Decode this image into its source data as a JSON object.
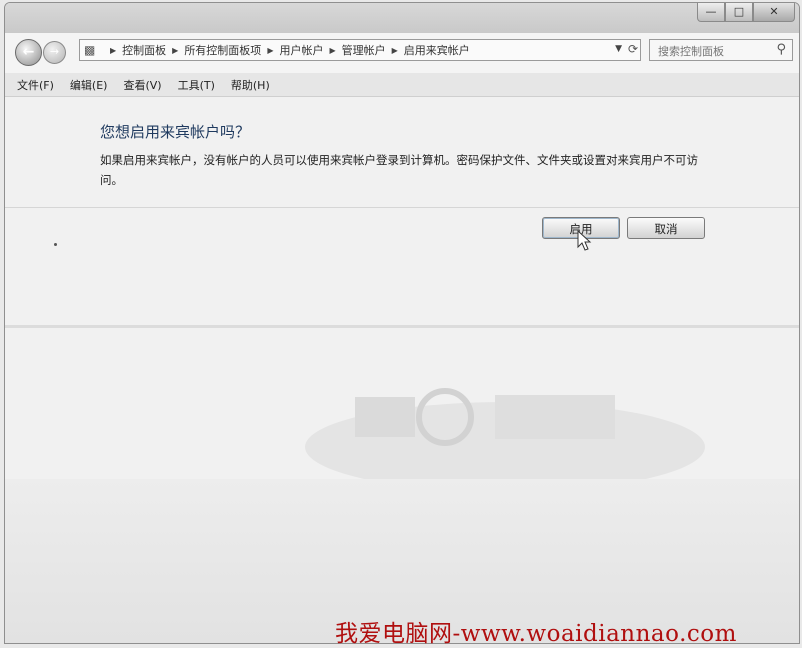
{
  "window": {
    "caption": {
      "minimize": "—",
      "maximize": "□",
      "close": "✕"
    }
  },
  "navigation": {
    "back_icon": "back-arrow-icon",
    "forward_icon": "forward-arrow-icon",
    "breadcrumbs": [
      "控制面板",
      "所有控制面板项",
      "用户帐户",
      "管理帐户",
      "启用来宾帐户"
    ],
    "search_placeholder": "搜索控制面板"
  },
  "menu": {
    "items": [
      "文件(F)",
      "编辑(E)",
      "查看(V)",
      "工具(T)",
      "帮助(H)"
    ]
  },
  "dialog": {
    "title": "您想启用来宾帐户吗？",
    "message": "如果启用来宾帐户，没有帐户的人员可以使用来宾帐户登录到计算机。密码保护文件、文件夹或设置对来宾用户不可访问。",
    "enable_label": "启用",
    "cancel_label": "取消"
  },
  "watermark": {
    "text": "我爱电脑网-www.woaidiannao.com",
    "color": "#b00f0f"
  }
}
